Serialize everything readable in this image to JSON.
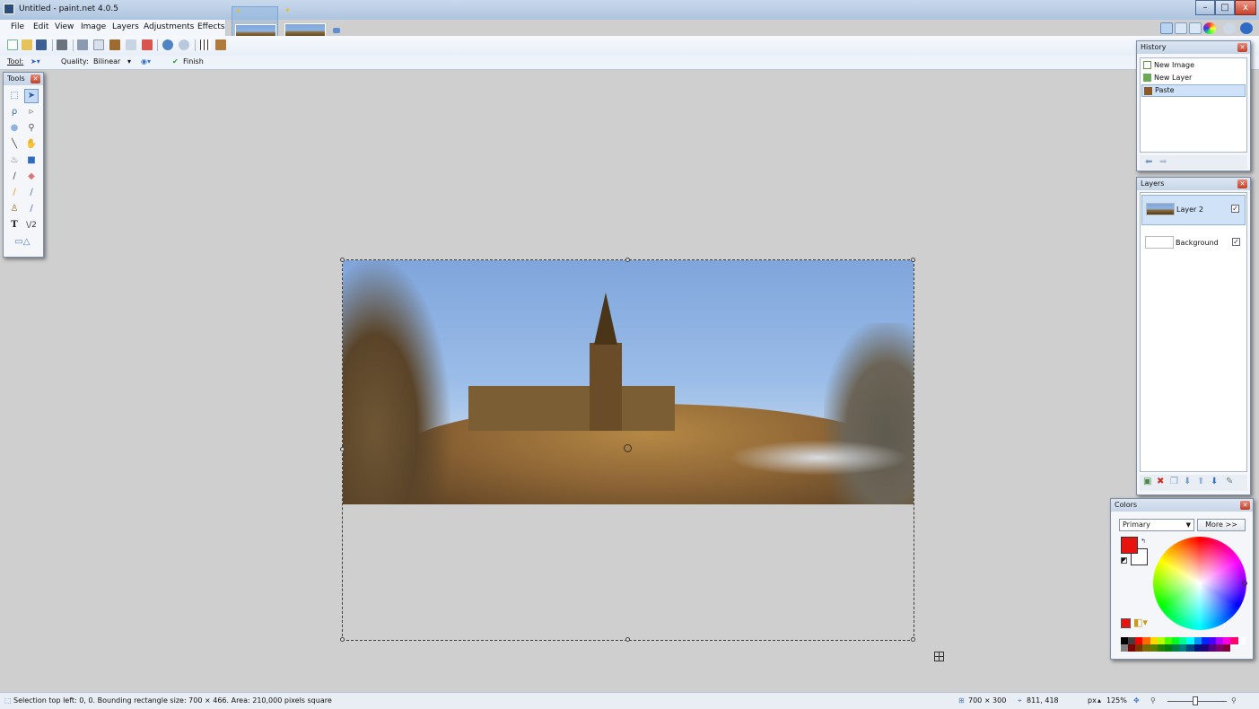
{
  "window": {
    "title": "Untitled - paint.net 4.0.5",
    "minimize": "–",
    "maximize": "□",
    "close": "x"
  },
  "menu": [
    "File",
    "Edit",
    "View",
    "Image",
    "Layers",
    "Adjustments",
    "Effects"
  ],
  "toolbar": {
    "tool_label": "Tool:",
    "quality_label": "Quality:",
    "quality_value": "Bilinear",
    "finish_label": "Finish"
  },
  "tools_panel": {
    "title": "Tools",
    "tools": [
      "rectangle-select",
      "move-selected-pixels",
      "lasso-select",
      "move-selection",
      "ellipse-select",
      "zoom",
      "magic-wand",
      "pan",
      "paint-bucket",
      "gradient",
      "paintbrush",
      "eraser",
      "pencil",
      "color-picker",
      "clone-stamp",
      "recolor",
      "text",
      "line-curve",
      "shapes"
    ],
    "text_glyph": "T",
    "line_glyph": "\\/2"
  },
  "history_panel": {
    "title": "History",
    "items": [
      {
        "label": "New Image",
        "icon": "new-image-icon",
        "active": false
      },
      {
        "label": "New Layer",
        "icon": "new-layer-icon",
        "active": false
      },
      {
        "label": "Paste",
        "icon": "paste-icon",
        "active": true
      }
    ]
  },
  "layers_panel": {
    "title": "Layers",
    "layers": [
      {
        "name": "Layer 2",
        "visible": true,
        "active": true
      },
      {
        "name": "Background",
        "visible": true,
        "active": false
      }
    ]
  },
  "colors_panel": {
    "title": "Colors",
    "mode": "Primary",
    "more_button": "More >>",
    "primary_color": "#e8120f",
    "secondary_color": "#ffffff"
  },
  "palette": [
    "#000000",
    "#404040",
    "#ff0000",
    "#ff6a00",
    "#ffd800",
    "#b6ff00",
    "#4cff00",
    "#00ff21",
    "#00ff90",
    "#00ffff",
    "#0094ff",
    "#0026ff",
    "#4800ff",
    "#b200ff",
    "#ff00dc",
    "#ff006e",
    "#ffffff",
    "#808080",
    "#7f0000",
    "#7f3300",
    "#7f6a00",
    "#5b7f00",
    "#267f00",
    "#007f0e",
    "#007f46",
    "#007f7f",
    "#004a7f",
    "#00137f",
    "#21007f",
    "#57007f",
    "#7f006e",
    "#7f0037"
  ],
  "status": {
    "selection_info": "Selection top left: 0, 0. Bounding rectangle size: 700 × 466. Area: 210,000 pixels square",
    "image_size": "700 × 300",
    "cursor_pos": "811, 418",
    "units": "px",
    "zoom": "125%"
  }
}
